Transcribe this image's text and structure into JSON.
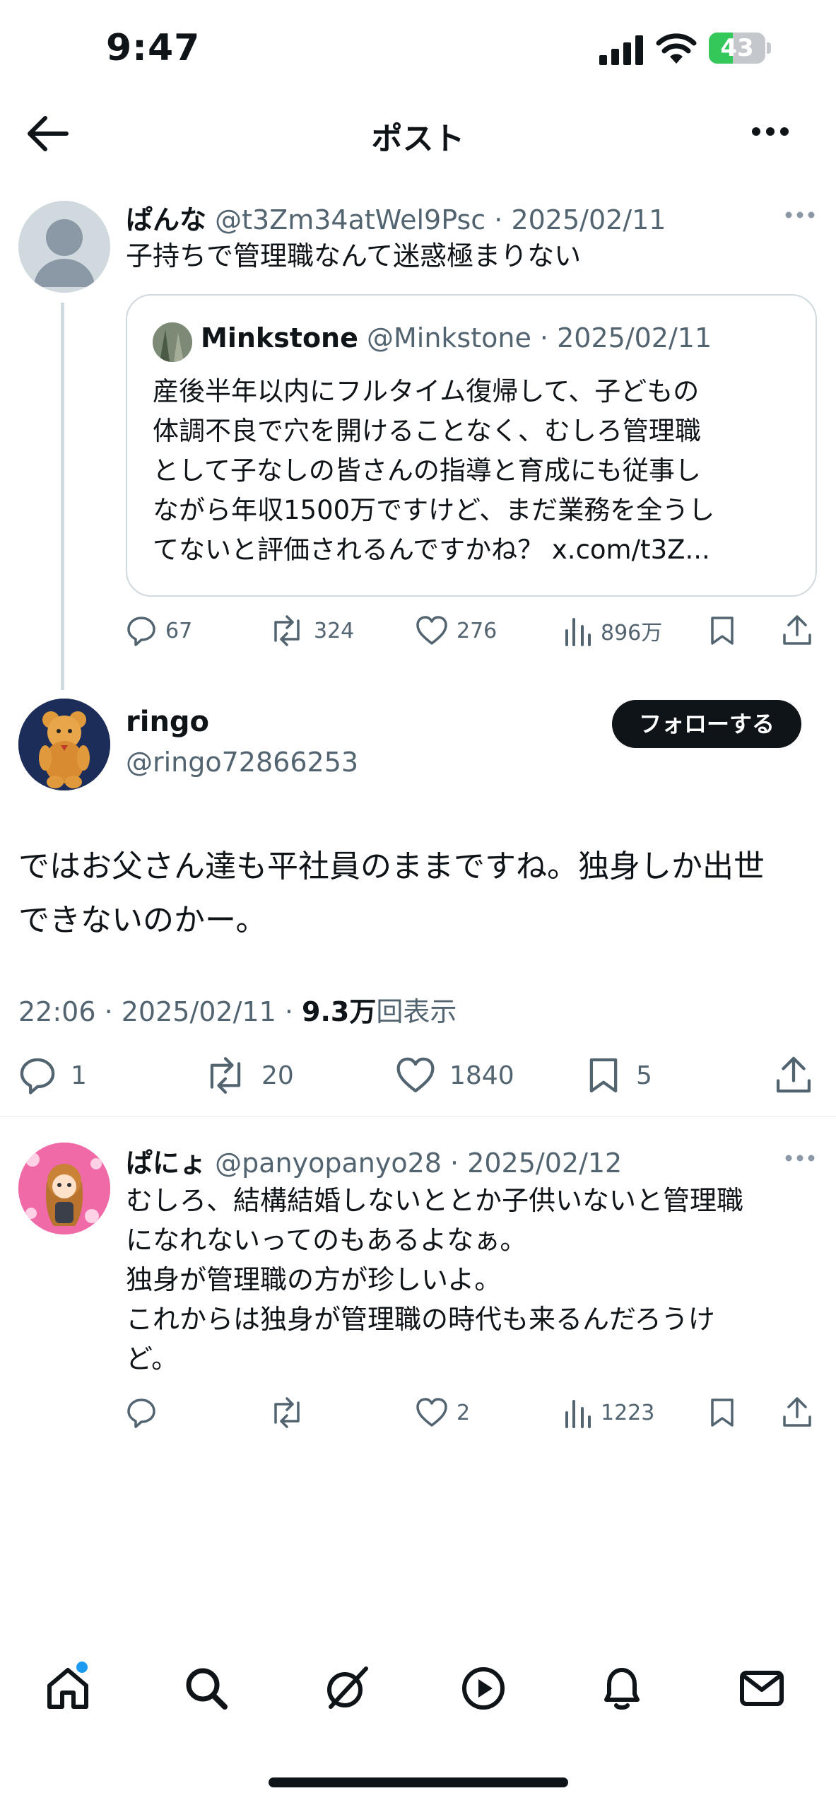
{
  "status_bar": {
    "time": "9:47",
    "battery": "43",
    "battery_level": 0.43
  },
  "header": {
    "title": "ポスト"
  },
  "parent_post": {
    "name": "ぱんな",
    "handle": "@t3Zm34atWel9Psc",
    "date": "2025/02/11",
    "text": "子持ちで管理職なんて迷惑極まりない",
    "quote": {
      "name": "Minkstone",
      "handle": "@Minkstone",
      "date": "2025/02/11",
      "lines": [
        "産後半年以内にフルタイム復帰して、子どもの",
        "体調不良で穴を開けることなく、むしろ管理職",
        "として子なしの皆さんの指導と育成にも従事し",
        "ながら年収1500万ですけど、まだ業務を全うし",
        "てないと評価されるんですかね？ x.com/t3Z..."
      ]
    },
    "actions": {
      "replies": "67",
      "reposts": "324",
      "likes": "276",
      "views": "896万"
    }
  },
  "main_post": {
    "name": "ringo",
    "handle": "@ringo72866253",
    "follow_label": "フォローする",
    "lines": [
      "ではお父さん達も平社員のままですね。独身しか出世",
      "できないのかー。"
    ],
    "timestamp": "22:06 · 2025/02/11 · ",
    "views_count": "9.3万",
    "views_suffix": "回表示",
    "actions": {
      "replies": "1",
      "reposts": "20",
      "likes": "1840",
      "bookmarks": "5"
    }
  },
  "reply_post": {
    "name": "ぱにょ",
    "handle": "@panyopanyo28",
    "date": "2025/02/12",
    "lines": [
      "むしろ、結構結婚しないととか子供いないと管理職",
      "になれないってのもあるよなぁ。",
      "独身が管理職の方が珍しいよ。",
      "これからは独身が管理職の時代も来るんだろうけ",
      "ど。"
    ],
    "actions": {
      "replies": "",
      "reposts": "",
      "likes": "2",
      "views": "1223"
    }
  },
  "tab_bar": {
    "items": [
      "home-icon",
      "search-icon",
      "grok-icon",
      "video-icon",
      "notifications-icon",
      "messages-icon"
    ]
  }
}
